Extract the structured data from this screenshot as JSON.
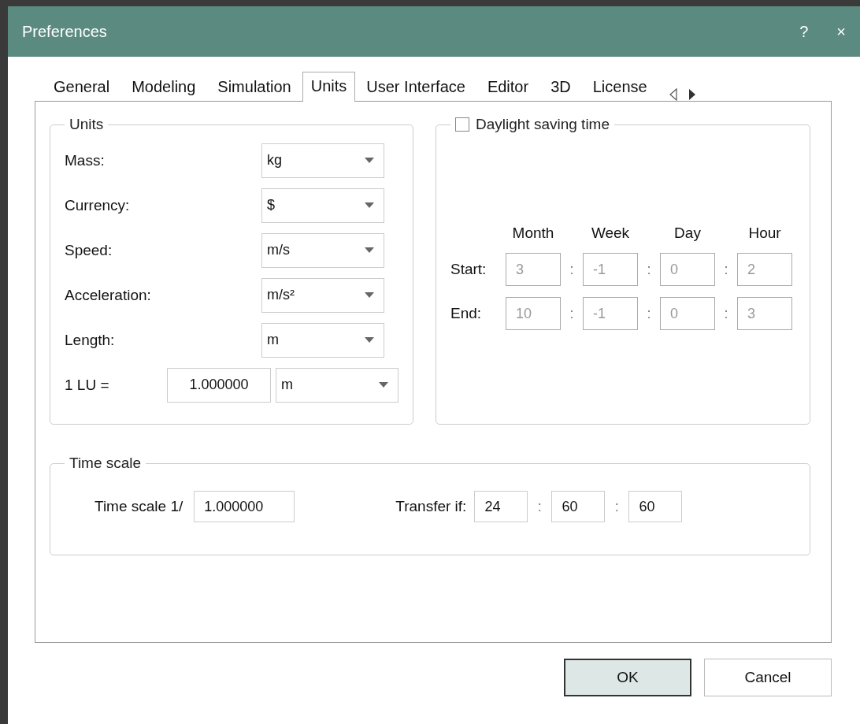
{
  "window": {
    "title": "Preferences",
    "help": "?",
    "close": "×"
  },
  "tabs": [
    {
      "label": "General",
      "selected": false
    },
    {
      "label": "Modeling",
      "selected": false
    },
    {
      "label": "Simulation",
      "selected": false
    },
    {
      "label": "Units",
      "selected": true
    },
    {
      "label": "User Interface",
      "selected": false
    },
    {
      "label": "Editor",
      "selected": false
    },
    {
      "label": "3D",
      "selected": false
    },
    {
      "label": "License",
      "selected": false
    }
  ],
  "units": {
    "title": "Units",
    "rows": [
      {
        "label": "Mass:",
        "value": "kg"
      },
      {
        "label": "Currency:",
        "value": "$"
      },
      {
        "label": "Speed:",
        "value": "m/s"
      },
      {
        "label": "Acceleration:",
        "value": "m/s²"
      },
      {
        "label": "Length:",
        "value": "m"
      },
      {
        "label": "1 LU =",
        "number": "1.000000",
        "value": "m"
      }
    ]
  },
  "daylight": {
    "label": "Daylight saving time",
    "checked": false,
    "columns": [
      "Month",
      "Week",
      "Day",
      "Hour"
    ],
    "rows": [
      {
        "label": "Start:",
        "values": [
          "3",
          "-1",
          "0",
          "2"
        ],
        "separators": [
          ":",
          ":",
          ":"
        ]
      },
      {
        "label": "End:",
        "values": [
          "10",
          "-1",
          "0",
          "3"
        ],
        "separators": [
          ":",
          ":",
          ":"
        ]
      }
    ]
  },
  "time_scale": {
    "title": "Time scale",
    "label": "Time scale 1/",
    "value": "1.000000",
    "transfer_label": "Transfer if:",
    "transfer": [
      "24",
      "60",
      "60"
    ],
    "separators": [
      ":",
      ":"
    ]
  },
  "buttons": [
    {
      "label": "OK",
      "default": true
    },
    {
      "label": "Cancel",
      "default": false
    }
  ]
}
